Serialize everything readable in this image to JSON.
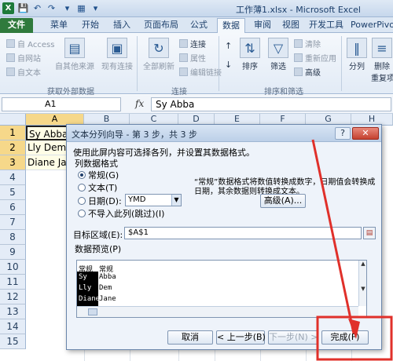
{
  "titlebar": {
    "excel_logo": "X",
    "title": "工作薄1.xlsx - Microsoft Excel"
  },
  "tabs": [
    "文件",
    "菜单",
    "开始",
    "插入",
    "页面布局",
    "公式",
    "数据",
    "审阅",
    "视图",
    "开发工具",
    "PowerPivot"
  ],
  "ribbon": {
    "external": {
      "items": [
        "自 Access",
        "自网站",
        "自文本"
      ],
      "from_other": "自其他来源",
      "existing": "现有连接",
      "label": "获取外部数据"
    },
    "connections": {
      "refresh_all": "全部刷新",
      "items": [
        "连接",
        "属性",
        "编辑链接"
      ],
      "label": "连接"
    },
    "sort_filter": {
      "sort": "排序",
      "filter": "筛选",
      "items": [
        "清除",
        "重新应用",
        "高级"
      ],
      "label": "排序和筛选"
    },
    "tools": {
      "split": "分列",
      "remove": "删除",
      "remove2": "重复项"
    }
  },
  "formula_bar": {
    "name_box": "A1",
    "fx": "fx",
    "value": "Sy Abba"
  },
  "sheet": {
    "columns": [
      "A",
      "B",
      "C",
      "D",
      "E",
      "F",
      "G",
      "H"
    ],
    "rows": [
      "1",
      "2",
      "3",
      "4",
      "5",
      "6",
      "7",
      "8",
      "9",
      "10",
      "11",
      "12",
      "13",
      "14",
      "15"
    ],
    "cells": [
      "Sy Abba",
      "Lly Dem",
      "Diane Jane"
    ]
  },
  "dialog": {
    "title": "文本分列向导 - 第 3 步，共 3 步",
    "help": "?",
    "close": "✕",
    "instruction": "使用此屏内容可选择各列，并设置其数据格式。",
    "format_legend": "列数据格式",
    "options": {
      "general": "常规(G)",
      "text": "文本(T)",
      "date": "日期(D):",
      "skip": "不导入此列(跳过)(I)"
    },
    "date_format": "YMD",
    "note_line1": "“常规”数据格式将数值转换成数字，日期值会转换成",
    "note_line2": "日期，其余数据则转换成文本。",
    "advanced_button": "高级(A)...",
    "destination_label": "目标区域(E):",
    "destination_value": "$A$1",
    "preview_label": "数据预览(P)",
    "preview": {
      "headers": [
        "常规",
        "常规"
      ],
      "rows": [
        [
          "Sy",
          "Abba"
        ],
        [
          "Lly",
          "Dem"
        ],
        [
          "Diane",
          "Jane"
        ]
      ]
    },
    "buttons": {
      "cancel": "取消",
      "back": "< 上一步(B)",
      "next": "下一步(N) >",
      "finish": "完成(F)"
    }
  },
  "colors": {
    "ribbon_bg": "#e2ebf6",
    "file_tab": "#2f7a3c",
    "selection_header": "#f6d88a",
    "annotation": "#e0302a"
  }
}
